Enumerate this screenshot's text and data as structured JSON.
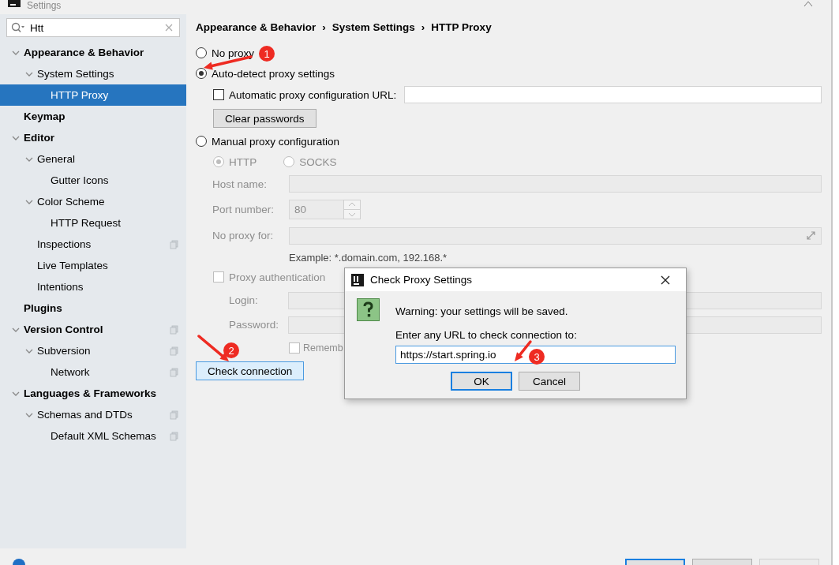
{
  "window": {
    "title": "Settings"
  },
  "search": {
    "value": "Htt"
  },
  "sidebar": {
    "items": [
      {
        "label": "Appearance & Behavior",
        "expanded": true,
        "selected": false,
        "scope_icon": false,
        "children": [
          {
            "label": "System Settings",
            "expanded": true,
            "selected": false,
            "scope_icon": false,
            "children": [
              {
                "label": "HTTP Proxy",
                "selected": true,
                "scope_icon": false
              }
            ]
          }
        ]
      },
      {
        "label": "Keymap",
        "selected": false,
        "scope_icon": false
      },
      {
        "label": "Editor",
        "expanded": true,
        "selected": false,
        "scope_icon": false,
        "children": [
          {
            "label": "General",
            "expanded": true,
            "selected": false,
            "scope_icon": false,
            "children": [
              {
                "label": "Gutter Icons",
                "selected": false,
                "scope_icon": false
              }
            ]
          },
          {
            "label": "Color Scheme",
            "expanded": true,
            "selected": false,
            "scope_icon": false,
            "children": [
              {
                "label": "HTTP Request",
                "selected": false,
                "scope_icon": false
              }
            ]
          },
          {
            "label": "Inspections",
            "selected": false,
            "scope_icon": true
          },
          {
            "label": "Live Templates",
            "selected": false,
            "scope_icon": false
          },
          {
            "label": "Intentions",
            "selected": false,
            "scope_icon": false
          }
        ]
      },
      {
        "label": "Plugins",
        "selected": false,
        "scope_icon": false
      },
      {
        "label": "Version Control",
        "expanded": true,
        "selected": false,
        "scope_icon": true,
        "children": [
          {
            "label": "Subversion",
            "expanded": true,
            "selected": false,
            "scope_icon": true,
            "children": [
              {
                "label": "Network",
                "selected": false,
                "scope_icon": true
              }
            ]
          }
        ]
      },
      {
        "label": "Languages & Frameworks",
        "expanded": true,
        "selected": false,
        "scope_icon": false,
        "children": [
          {
            "label": "Schemas and DTDs",
            "expanded": true,
            "selected": false,
            "scope_icon": true,
            "children": [
              {
                "label": "Default XML Schemas",
                "selected": false,
                "scope_icon": true
              }
            ]
          }
        ]
      }
    ]
  },
  "breadcrumb": {
    "separator": "›",
    "items": [
      "Appearance & Behavior",
      "System Settings",
      "HTTP Proxy"
    ]
  },
  "form": {
    "rows": [
      {
        "kind": "radio",
        "label": "No proxy",
        "selected": false
      },
      {
        "kind": "radio",
        "label": "Auto-detect proxy settings",
        "selected": true
      },
      {
        "kind": "checkbox_field",
        "label": "Automatic proxy configuration URL:",
        "checked": false
      },
      {
        "kind": "button",
        "label": "Clear passwords"
      },
      {
        "kind": "radio",
        "label": "Manual proxy configuration",
        "selected": false
      },
      {
        "kind": "protocols",
        "disabled": true,
        "options": [
          {
            "label": "HTTP",
            "selected": true
          },
          {
            "label": "SOCKS",
            "selected": false
          }
        ]
      },
      {
        "kind": "field",
        "label": "Host name:",
        "disabled": true
      },
      {
        "kind": "spinner",
        "label": "Port number:",
        "value": "80",
        "disabled": true
      },
      {
        "kind": "expand_field",
        "label": "No proxy for:",
        "disabled": true
      },
      {
        "kind": "hint",
        "text": "Example: *.domain.com, 192.168.*"
      },
      {
        "kind": "checkbox",
        "label": "Proxy authentication",
        "checked": false,
        "disabled": true
      },
      {
        "kind": "sub_field",
        "label": "Login:",
        "disabled": true
      },
      {
        "kind": "sub_field",
        "label": "Password:",
        "disabled": true
      },
      {
        "kind": "sub_checkbox",
        "label": "Rememb",
        "checked": false,
        "disabled": true
      },
      {
        "kind": "action_button",
        "label": "Check connection",
        "focused": true
      }
    ]
  },
  "dialog": {
    "title": "Check Proxy Settings",
    "warning": "Warning: your settings will be saved.",
    "prompt": "Enter any URL to check connection to:",
    "url": "https://start.spring.io",
    "buttons": [
      {
        "label": "OK",
        "default": true
      },
      {
        "label": "Cancel",
        "default": false
      }
    ]
  },
  "annotations": [
    {
      "number": "1"
    },
    {
      "number": "2"
    },
    {
      "number": "3"
    }
  ]
}
